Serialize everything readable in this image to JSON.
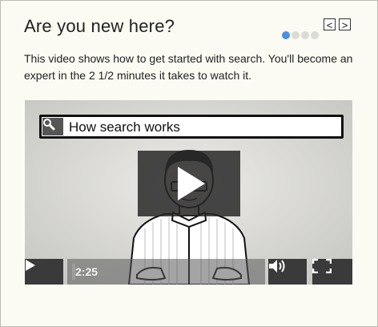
{
  "header": {
    "title": "Are you new here?",
    "prev_glyph": "<",
    "next_glyph": ">",
    "slide_index": 1,
    "slide_count": 4
  },
  "description": "This video shows how to get started with search. You'll become an expert in the 2 1/2 minutes it takes to watch it.",
  "video": {
    "search_text": "How search works",
    "time": "2:25",
    "accent_color": "#4a90e2"
  },
  "icons": [
    "chevron-left-icon",
    "chevron-right-icon",
    "search-icon",
    "play-icon",
    "volume-icon",
    "fullscreen-icon"
  ]
}
